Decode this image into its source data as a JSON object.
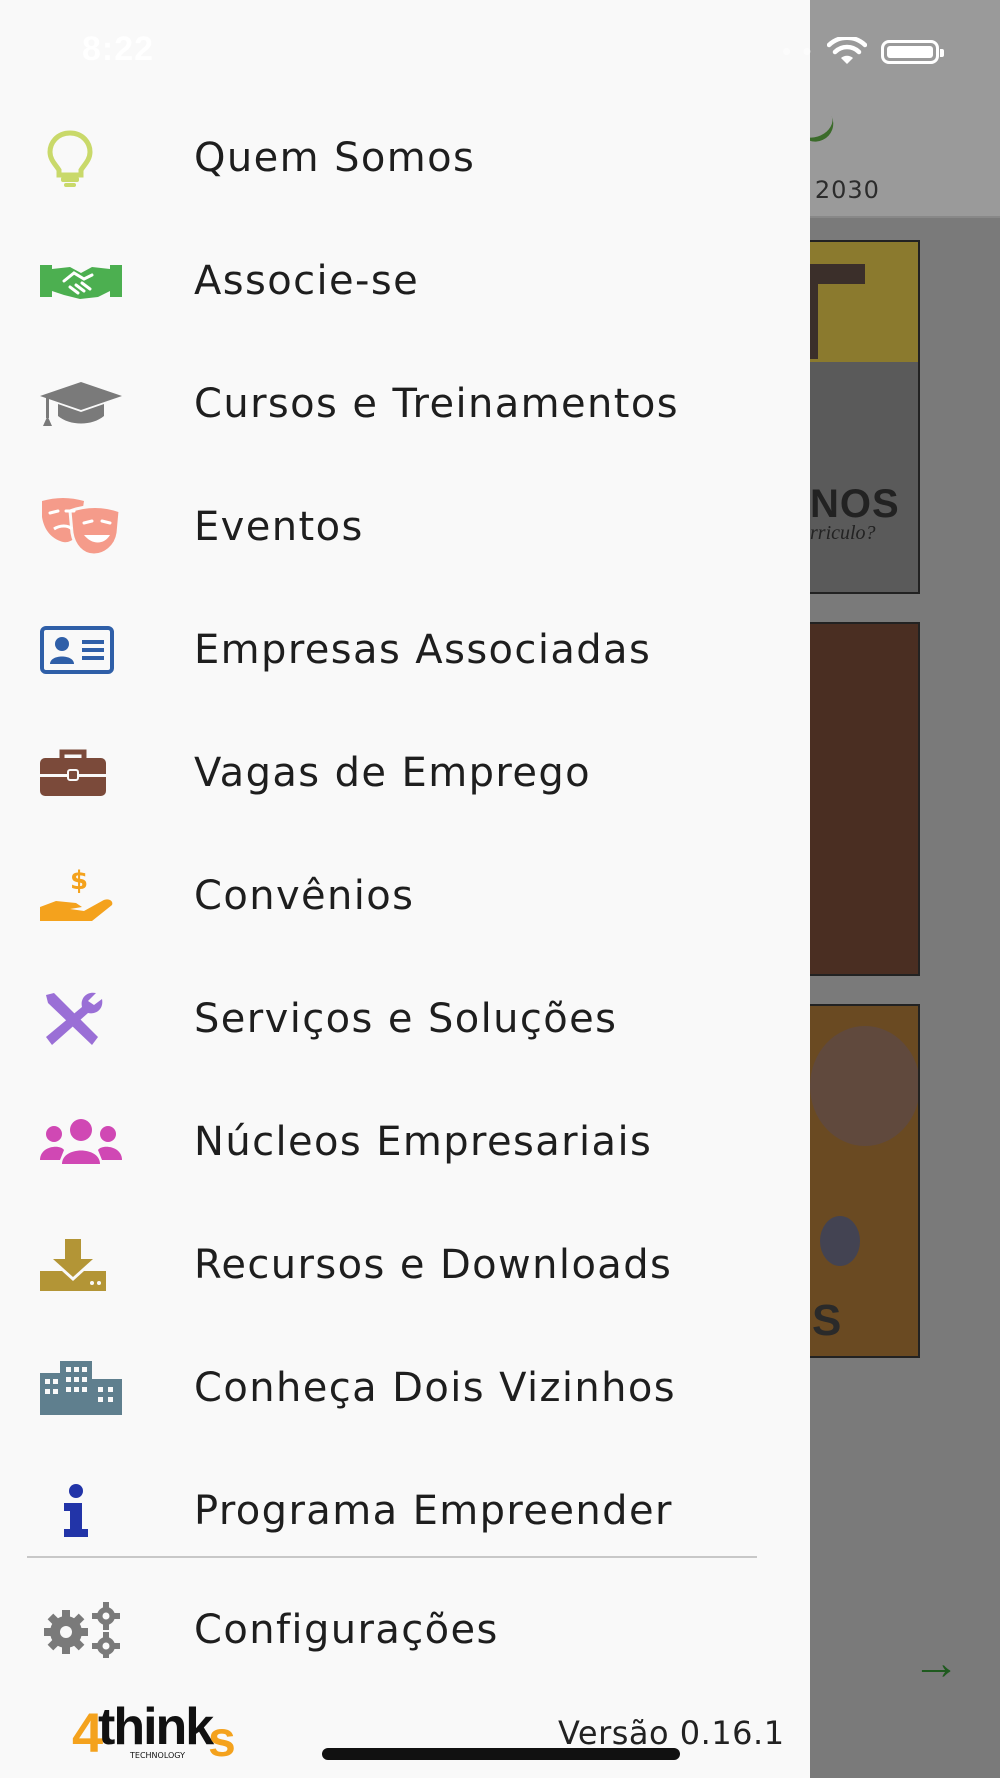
{
  "status_bar": {
    "time": "8:22"
  },
  "background_app": {
    "header_text": "S 2030",
    "card1_title": "NOS",
    "card1_subtitle": "rriculo?",
    "card3_title": "S"
  },
  "drawer": {
    "items": [
      {
        "label": "Quem Somos",
        "icon": "lightbulb-icon",
        "color": "#c9d96a"
      },
      {
        "label": "Associe-se",
        "icon": "handshake-icon",
        "color": "#4caf50"
      },
      {
        "label": "Cursos e Treinamentos",
        "icon": "graduation-cap-icon",
        "color": "#7a7a7a"
      },
      {
        "label": "Eventos",
        "icon": "theater-masks-icon",
        "color": "#f59b8a"
      },
      {
        "label": "Empresas Associadas",
        "icon": "id-card-icon",
        "color": "#2f5fa8"
      },
      {
        "label": "Vagas de Emprego",
        "icon": "briefcase-icon",
        "color": "#7b4a3a"
      },
      {
        "label": "Convênios",
        "icon": "hand-money-icon",
        "color": "#f4a21d"
      },
      {
        "label": "Serviços e Soluções",
        "icon": "tools-icon",
        "color": "#9a6fd6"
      },
      {
        "label": "Núcleos Empresariais",
        "icon": "users-icon",
        "color": "#d048b4"
      },
      {
        "label": "Recursos e Downloads",
        "icon": "download-icon",
        "color": "#b39536"
      },
      {
        "label": "Conheça Dois Vizinhos",
        "icon": "city-icon",
        "color": "#5f7f8e"
      },
      {
        "label": "Programa Empreender",
        "icon": "info-icon",
        "color": "#2234a8"
      }
    ],
    "settings": {
      "label": "Configurações",
      "icon": "gears-icon",
      "color": "#7a7a7a"
    },
    "footer": {
      "logo_text_main": "4thinks",
      "logo_text_sub": "TECHNOLOGY",
      "version": "Versão 0.16.1"
    }
  }
}
